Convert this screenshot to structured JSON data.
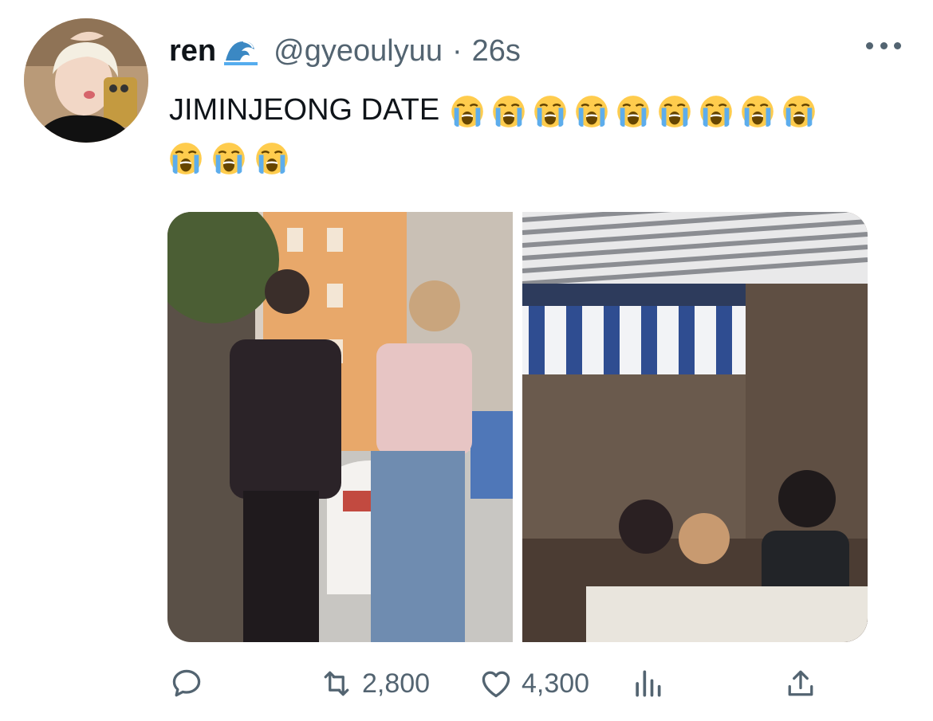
{
  "tweet": {
    "author_name": "ren",
    "author_badge_icon": "wave-emoji",
    "handle": "@gyeoulyuu",
    "separator": "·",
    "time": "26s",
    "text": "JIMINJEONG DATE",
    "emoji_icon": "loudly-crying-face-emoji",
    "emoji_count_line1": 9,
    "emoji_count_line2": 3,
    "images": [
      {
        "alt_icon": "photo-two-people-street"
      },
      {
        "alt_icon": "photo-people-under-awning"
      }
    ]
  },
  "actions": {
    "reply_icon": "reply-icon",
    "retweet_icon": "retweet-icon",
    "retweet_count": "2,800",
    "like_icon": "heart-icon",
    "like_count": "4,300",
    "analytics_icon": "analytics-icon",
    "share_icon": "share-icon"
  },
  "colors": {
    "text": "#0f1419",
    "secondary": "#536471"
  }
}
